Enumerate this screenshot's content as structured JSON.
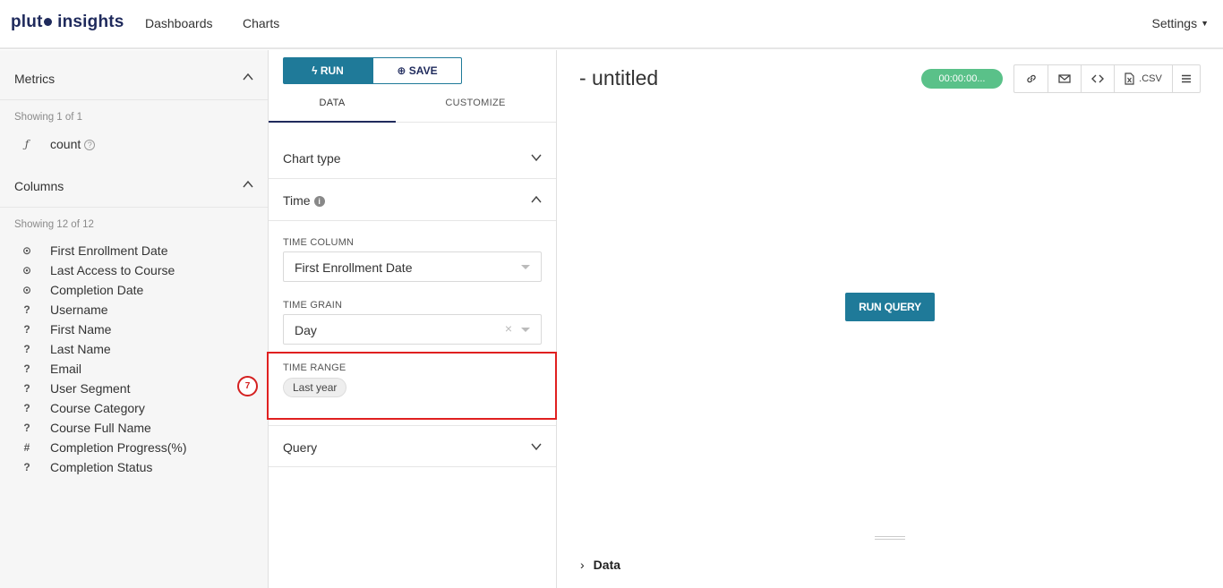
{
  "brand": {
    "name_part1": "plut",
    "name_part2": "insights"
  },
  "nav": {
    "dashboards": "Dashboards",
    "charts": "Charts",
    "settings": "Settings"
  },
  "sidebar": {
    "metrics_title": "Metrics",
    "metrics_showing": "Showing 1 of 1",
    "metrics": [
      {
        "icon": "ƒ",
        "label": "count"
      }
    ],
    "columns_title": "Columns",
    "columns_showing": "Showing 12 of 12",
    "columns": [
      {
        "icon": "clock-icon",
        "glyph": "⊙",
        "label": "First Enrollment Date"
      },
      {
        "icon": "clock-icon",
        "glyph": "⊙",
        "label": "Last Access to Course"
      },
      {
        "icon": "clock-icon",
        "glyph": "⊙",
        "label": "Completion Date"
      },
      {
        "icon": "question-icon",
        "glyph": "?",
        "label": "Username"
      },
      {
        "icon": "question-icon",
        "glyph": "?",
        "label": "First Name"
      },
      {
        "icon": "question-icon",
        "glyph": "?",
        "label": "Last Name"
      },
      {
        "icon": "question-icon",
        "glyph": "?",
        "label": "Email"
      },
      {
        "icon": "question-icon",
        "glyph": "?",
        "label": "User Segment"
      },
      {
        "icon": "question-icon",
        "glyph": "?",
        "label": "Course Category"
      },
      {
        "icon": "question-icon",
        "glyph": "?",
        "label": "Course Full Name"
      },
      {
        "icon": "hash-icon",
        "glyph": "#",
        "label": "Completion Progress(%)"
      },
      {
        "icon": "question-icon",
        "glyph": "?",
        "label": "Completion Status"
      }
    ],
    "annotation_badge": "7"
  },
  "controls": {
    "run_label": "RUN",
    "save_label": "SAVE",
    "tab_data": "DATA",
    "tab_customize": "CUSTOMIZE",
    "chart_type": "Chart type",
    "time": "Time",
    "time_column_label": "TIME COLUMN",
    "time_column_value": "First Enrollment Date",
    "time_grain_label": "TIME GRAIN",
    "time_grain_value": "Day",
    "time_range_label": "TIME RANGE",
    "time_range_value": "Last year",
    "query": "Query"
  },
  "main": {
    "title": "- untitled",
    "timer": "00:00:00...",
    "csv_label": ".CSV",
    "run_query": "RUN QUERY",
    "data_label": "Data"
  },
  "colors": {
    "accent": "#1f7a99",
    "brand": "#1f2a5c",
    "timer": "#5ac189",
    "highlight": "#e02020"
  }
}
